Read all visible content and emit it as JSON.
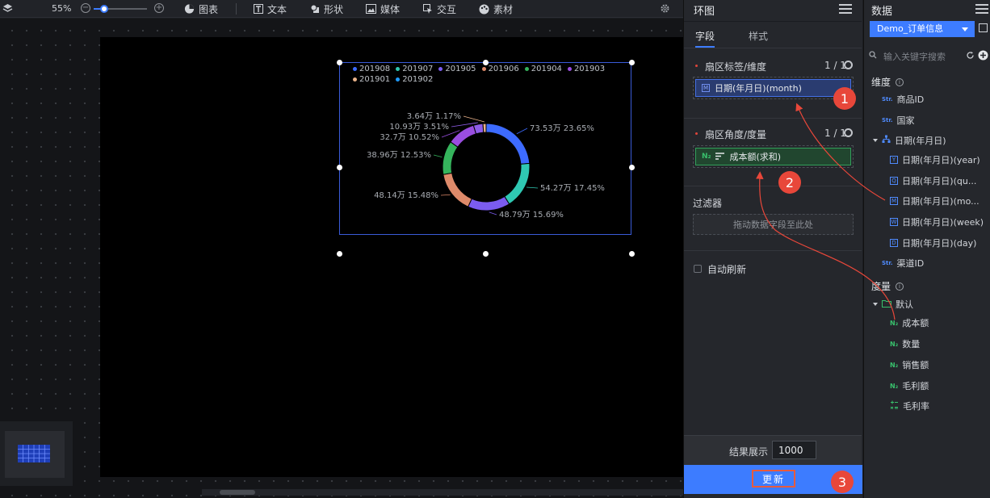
{
  "toolbar": {
    "zoom": "55%",
    "zoom_minus": "−",
    "zoom_plus": "+",
    "zoom_level_fraction": 0.2,
    "items": [
      {
        "label": "图表",
        "icon": "pie-chart-icon"
      },
      {
        "label": "文本",
        "icon": "text-icon"
      },
      {
        "label": "形状",
        "icon": "shape-icon"
      },
      {
        "label": "媒体",
        "icon": "image-icon"
      },
      {
        "label": "交互",
        "icon": "cursor-icon"
      },
      {
        "label": "素材",
        "icon": "palette-icon"
      }
    ]
  },
  "chart_data": {
    "type": "pie",
    "variant": "donut",
    "legend": [
      "201908",
      "201907",
      "201905",
      "201906",
      "201904",
      "201903",
      "201901",
      "201902"
    ],
    "slices": [
      {
        "label": "73.53万 23.65%",
        "value": 23.65,
        "color": "#3d6bff"
      },
      {
        "label": "54.27万 17.45%",
        "value": 17.45,
        "color": "#2fc8b3"
      },
      {
        "label": "48.79万 15.69%",
        "value": 15.69,
        "color": "#7b5cf0"
      },
      {
        "label": "48.14万 15.48%",
        "value": 15.48,
        "color": "#de8a6a"
      },
      {
        "label": "38.96万 12.53%",
        "value": 12.53,
        "color": "#35b45c"
      },
      {
        "label": "32.7万 10.52%",
        "value": 10.52,
        "color": "#9a4ee0"
      },
      {
        "label": "10.93万 3.51%",
        "value": 3.51,
        "color": "#8f5de8"
      },
      {
        "label": "3.64万 1.17%",
        "value": 1.17,
        "color": "#e9b28a"
      }
    ],
    "legend_colors": [
      "#3d6bff",
      "#2fc8b3",
      "#7b5cf0",
      "#de8a6a",
      "#35b45c",
      "#9a4ee0",
      "#e9b28a",
      "#1e9bff"
    ]
  },
  "panel": {
    "title": "环图",
    "tabs": [
      "字段",
      "样式"
    ],
    "dimension": {
      "label": "扇区标签/维度",
      "count": "1 / 1",
      "field": "日期(年月日)(month)",
      "badge": "M"
    },
    "measure": {
      "label": "扇区角度/度量",
      "count": "1 / 1",
      "field": "成本额(求和)",
      "badge": "N₂"
    },
    "filter": {
      "label": "过滤器",
      "placeholder": "拖动数据字段至此处"
    },
    "auto_refresh": "自动刷新",
    "result_label": "结果展示",
    "result_value": "1000",
    "update": "更新"
  },
  "data_panel": {
    "title": "数据",
    "dataset": "Demo_订单信息",
    "search_placeholder": "输入关键字搜索",
    "dimension_group": "维度",
    "fields": [
      {
        "name": "商品ID",
        "type": "Str."
      },
      {
        "name": "国家",
        "type": "Str."
      },
      {
        "name": "日期(年月日)",
        "type": "hier"
      },
      {
        "name": "日期(年月日)(year)",
        "type": "Y"
      },
      {
        "name": "日期(年月日)(qu...",
        "type": "Q"
      },
      {
        "name": "日期(年月日)(mo...",
        "type": "M"
      },
      {
        "name": "日期(年月日)(week)",
        "type": "W"
      },
      {
        "name": "日期(年月日)(day)",
        "type": "D"
      },
      {
        "name": "渠道ID",
        "type": "Str."
      }
    ],
    "measure_group": "度量",
    "folder": "默认",
    "measures": [
      {
        "name": "成本额",
        "type": "N₂"
      },
      {
        "name": "数量",
        "type": "N₂"
      },
      {
        "name": "销售额",
        "type": "N₂"
      },
      {
        "name": "毛利额",
        "type": "N₂"
      },
      {
        "name": "毛利率",
        "type": "calc"
      }
    ]
  },
  "callouts": [
    "1",
    "2",
    "3"
  ]
}
